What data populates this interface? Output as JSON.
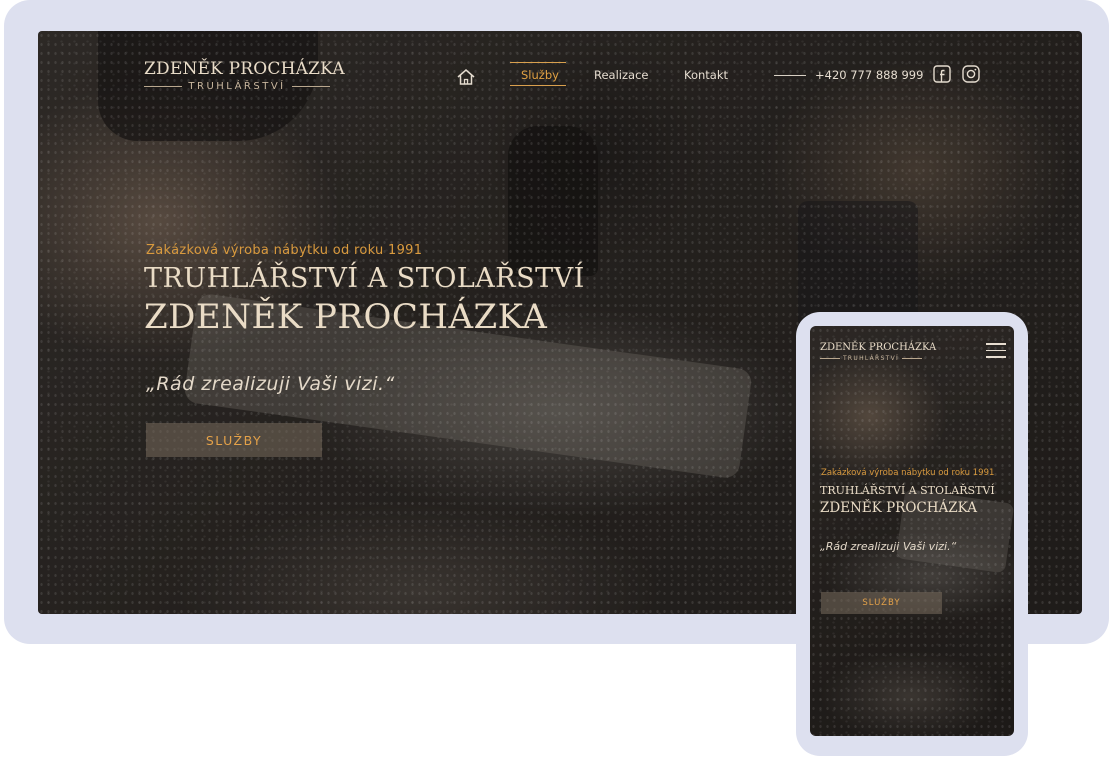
{
  "brand": {
    "name": "ZDENĚK PROCHÁZKA",
    "subtitle": "TRUHLÁŘSTVÍ"
  },
  "nav": {
    "home_icon": "home-icon",
    "items": [
      {
        "label": "Služby",
        "active": true
      },
      {
        "label": "Realizace",
        "active": false
      },
      {
        "label": "Kontakt",
        "active": false
      }
    ],
    "phone": "+420 777 888 999",
    "social": [
      "facebook-icon",
      "instagram-icon"
    ]
  },
  "hero": {
    "tagline": "Zakázková výroba nábytku od roku 1991",
    "title_line1": "TRUHLÁŘSTVÍ A STOLAŘSTVÍ",
    "title_line2": "ZDENĚK PROCHÁZKA",
    "quote": "„Rád zrealizuji Vaši vizi.“",
    "button_label": "SLUŽBY"
  },
  "mobile": {
    "menu_icon": "hamburger-menu-icon"
  },
  "colors": {
    "accent": "#e0a043",
    "text_light": "#eadcc6",
    "frame": "#dde0ef"
  }
}
